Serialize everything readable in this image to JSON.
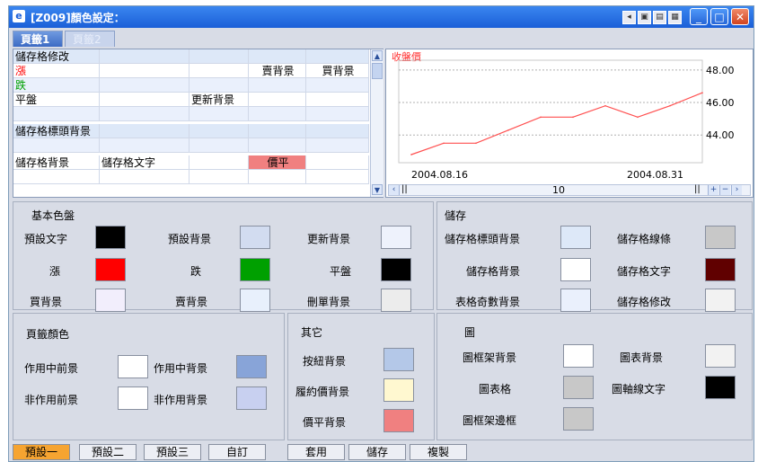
{
  "window": {
    "title": "[Z009]顏色設定：",
    "titlebar_icon": "app-e-icon",
    "toolbar_icons": [
      "tb-a-icon",
      "tb-b-icon",
      "tb-c-icon",
      "tb-d-icon"
    ],
    "controls": [
      "minimize-icon",
      "maximize-icon",
      "close-icon"
    ]
  },
  "tabs": [
    {
      "label": "頁籤1",
      "active": true
    },
    {
      "label": "頁籤2",
      "active": false
    }
  ],
  "grid": {
    "rows": [
      [
        "儲存格修改",
        "",
        "",
        "",
        ""
      ],
      [
        "漲",
        "",
        "",
        "賣背景",
        "買背景"
      ],
      [
        "跌",
        "",
        "",
        "",
        ""
      ],
      [
        "平盤",
        "",
        "更新背景",
        "",
        ""
      ],
      [
        "",
        "",
        "",
        "",
        ""
      ],
      [
        "儲存格標頭背景",
        "",
        "",
        "",
        ""
      ],
      [
        "",
        "",
        "",
        "",
        ""
      ],
      [
        "儲存格背景",
        "儲存格文字",
        "",
        "價平",
        ""
      ],
      [
        "",
        "",
        "",
        "",
        ""
      ]
    ]
  },
  "chart_data": {
    "type": "line",
    "title": "收盤價",
    "x_start": "2004.08.16",
    "x_end": "2004.08.31",
    "x_tick_labels": [
      "2004.08.16",
      "2004.08.31"
    ],
    "y_tick_labels": [
      "48.00",
      "46.00",
      "44.00"
    ],
    "ylim": [
      42.3,
      48.6
    ],
    "series": [
      {
        "name": "收盤價",
        "color": "#ff5050",
        "values": [
          42.8,
          43.5,
          43.5,
          44.3,
          45.1,
          45.1,
          45.8,
          45.1,
          45.8,
          46.6
        ]
      }
    ],
    "scroll_value": "10"
  },
  "colors": {
    "basic": {
      "title": "基本色盤",
      "items": [
        {
          "label": "預設文字",
          "color": "#000000"
        },
        {
          "label": "預設背景",
          "color": "#d2dcf0"
        },
        {
          "label": "更新背景",
          "color": "#eef2fc"
        },
        {
          "label": "漲",
          "color": "#ff0000"
        },
        {
          "label": "跌",
          "color": "#00a000"
        },
        {
          "label": "平盤",
          "color": "#000000"
        },
        {
          "label": "買背景",
          "color": "#f2eefc"
        },
        {
          "label": "賣背景",
          "color": "#e8f0fc"
        },
        {
          "label": "刪單背景",
          "color": "#ececec"
        }
      ]
    },
    "storage": {
      "title": "儲存",
      "items": [
        {
          "label": "儲存格標頭背景",
          "color": "#dde8f8"
        },
        {
          "label": "儲存格線條",
          "color": "#c8c8c8"
        },
        {
          "label": "儲存格背景",
          "color": "#ffffff"
        },
        {
          "label": "儲存格文字",
          "color": "#600000"
        },
        {
          "label": "表格奇數背景",
          "color": "#eaf0fc"
        },
        {
          "label": "儲存格修改",
          "color": "#f2f2f2"
        }
      ]
    },
    "tab_color": {
      "title": "頁籤顏色",
      "items": [
        {
          "label": "作用中前景",
          "color": "#ffffff"
        },
        {
          "label": "作用中背景",
          "color": "#88a4d8"
        },
        {
          "label": "非作用前景",
          "color": "#ffffff"
        },
        {
          "label": "非作用背景",
          "color": "#c8d0f0"
        }
      ]
    },
    "other": {
      "title": "其它",
      "items": [
        {
          "label": "按紐背景",
          "color": "#b4c8e8"
        },
        {
          "label": "履約價背景",
          "color": "#fff8d0"
        },
        {
          "label": "價平背景",
          "color": "#f08080"
        }
      ]
    },
    "chart": {
      "title": "圖",
      "items": [
        {
          "label": "圖框架背景",
          "color": "#ffffff"
        },
        {
          "label": "圖表背景",
          "color": "#f2f2f2"
        },
        {
          "label": "圖表格",
          "color": "#c8c8c8"
        },
        {
          "label": "圖軸線文字",
          "color": "#000000"
        },
        {
          "label": "圖框架邊框",
          "color": "#c8c8c8"
        }
      ]
    }
  },
  "buttons": {
    "presets": [
      {
        "label": "預設一",
        "selected": true
      },
      {
        "label": "預設二",
        "selected": false
      },
      {
        "label": "預設三",
        "selected": false
      },
      {
        "label": "自訂",
        "selected": false
      }
    ],
    "actions": [
      "套用",
      "儲存",
      "複製"
    ]
  }
}
